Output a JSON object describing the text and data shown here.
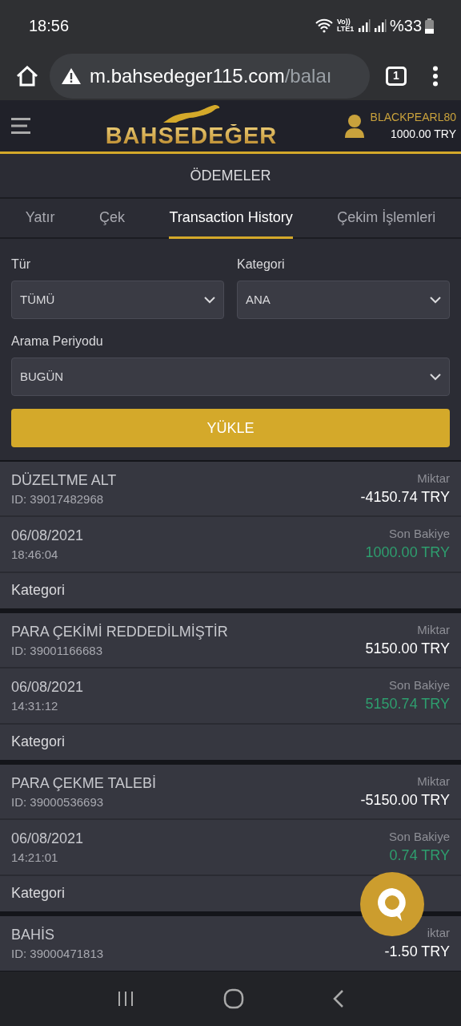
{
  "status_bar": {
    "time": "18:56",
    "network": "Vo)) LTE1",
    "battery": "%33"
  },
  "browser": {
    "url_host": "m.bahsedeger115.com",
    "url_path": "/balaı",
    "tab_count": "1"
  },
  "header": {
    "logo_text": "BAHSEDEĞER",
    "username": "BLACKPEARL80",
    "balance": "1000.00 TRY"
  },
  "page_title": "ÖDEMELER",
  "tabs": [
    {
      "label": "Yatır",
      "selected": false
    },
    {
      "label": "Çek",
      "selected": false
    },
    {
      "label": "Transaction History",
      "selected": true
    },
    {
      "label": "Çekim İşlemleri",
      "selected": false
    }
  ],
  "filters": [
    {
      "label": "Tür",
      "value": "TÜMÜ"
    },
    {
      "label": "Kategori",
      "value": "ANA"
    },
    {
      "label": "Arama Periyodu",
      "value": "BUGÜN"
    }
  ],
  "load_button": "YÜKLE",
  "transactions": [
    {
      "title": "DÜZELTME ALT",
      "id": "ID: 39017482968",
      "amount_label": "Miktar",
      "amount": "-4150.74 TRY",
      "date": "06/08/2021",
      "time": "18:46:04",
      "balance_label": "Son Bakiye",
      "balance": "1000.00 TRY",
      "category_label": "Kategori"
    },
    {
      "title": "PARA ÇEKİMİ REDDEDİLMİŞTİR",
      "id": "ID: 39001166683",
      "amount_label": "Miktar",
      "amount": "5150.00 TRY",
      "date": "06/08/2021",
      "time": "14:31:12",
      "balance_label": "Son Bakiye",
      "balance": "5150.74 TRY",
      "category_label": "Kategori"
    },
    {
      "title": "PARA ÇEKME TALEBİ",
      "id": "ID: 39000536693",
      "amount_label": "Miktar",
      "amount": "-5150.00 TRY",
      "date": "06/08/2021",
      "time": "14:21:01",
      "balance_label": "Son Bakiye",
      "balance": "0.74 TRY",
      "category_label": "Kategori"
    },
    {
      "title": "BAHİS",
      "id": "ID: 39000471813",
      "amount_label": "iktar",
      "amount": "-1.50 TRY"
    }
  ]
}
